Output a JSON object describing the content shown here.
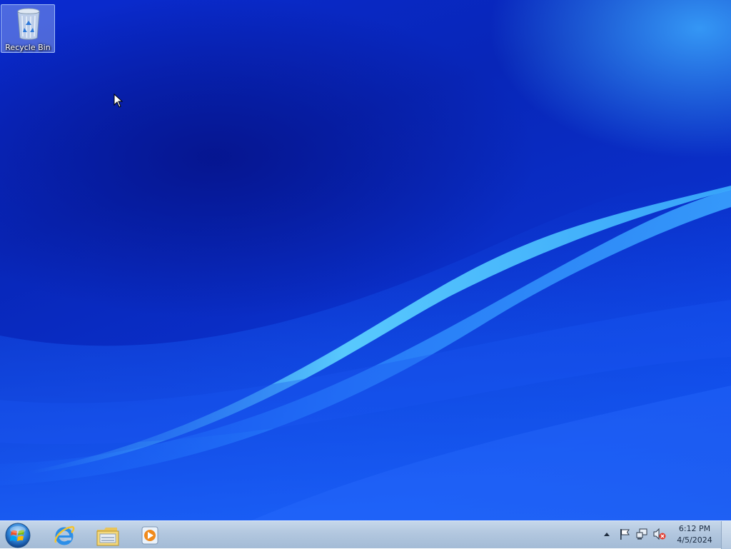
{
  "desktop": {
    "icons": [
      {
        "label": "Recycle Bin",
        "icon": "recycle-bin-icon"
      }
    ]
  },
  "taskbar": {
    "start_icon": "windows-start-orb-icon",
    "pinned": [
      {
        "app": "Internet Explorer",
        "icon": "internet-explorer-icon"
      },
      {
        "app": "Windows Explorer",
        "icon": "folder-icon"
      },
      {
        "app": "Windows Media Player",
        "icon": "media-player-icon"
      }
    ],
    "tray": {
      "icons": [
        "show-hidden-icons-chevron",
        "action-center-flag-icon",
        "network-icon",
        "volume-muted-icon"
      ],
      "time": "6:12 PM",
      "date": "4/5/2024"
    }
  },
  "colors": {
    "wallpaper_base": "#0a2bd0",
    "taskbar": "#b2c7df"
  }
}
